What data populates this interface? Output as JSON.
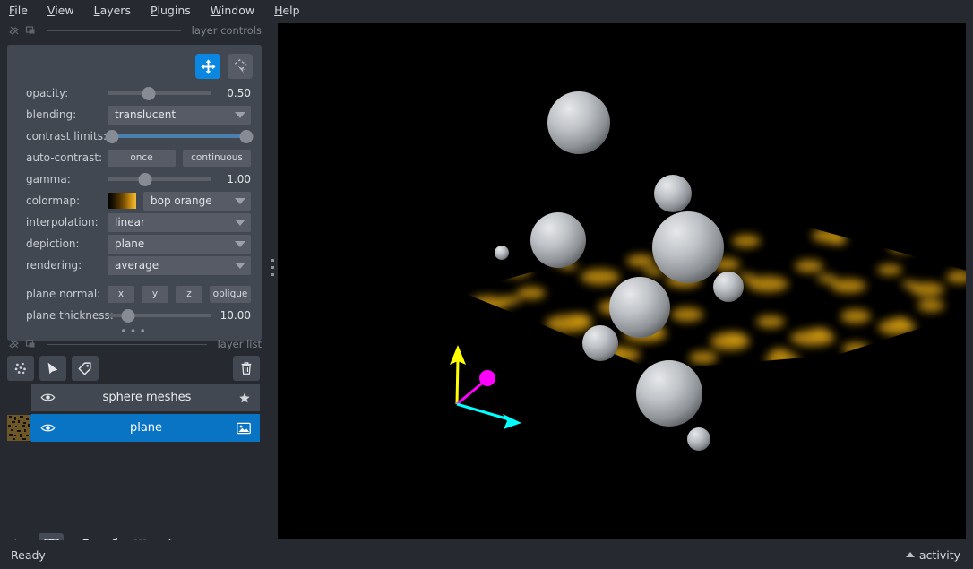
{
  "menubar": {
    "items": [
      {
        "label": "File",
        "mnemonic": "F"
      },
      {
        "label": "View",
        "mnemonic": "V"
      },
      {
        "label": "Layers",
        "mnemonic": "L"
      },
      {
        "label": "Plugins",
        "mnemonic": "P"
      },
      {
        "label": "Window",
        "mnemonic": "W"
      },
      {
        "label": "Help",
        "mnemonic": "H"
      }
    ]
  },
  "docks": {
    "layer_controls_title": "layer controls",
    "layer_list_title": "layer list",
    "overflow_dots": "•••"
  },
  "layer_controls": {
    "tools": [
      {
        "name": "pan-zoom-tool",
        "active": true
      },
      {
        "name": "transform-tool",
        "active": false
      }
    ],
    "opacity": {
      "label": "opacity:",
      "value": "0.50",
      "fraction": 0.4
    },
    "blending": {
      "label": "blending:",
      "value": "translucent"
    },
    "contrast_limits": {
      "label": "contrast limits:",
      "low": 0.0,
      "high": 1.0
    },
    "auto_contrast": {
      "label": "auto-contrast:",
      "once": "once",
      "continuous": "continuous"
    },
    "gamma": {
      "label": "gamma:",
      "value": "1.00",
      "fraction": 0.36
    },
    "colormap": {
      "label": "colormap:",
      "value": "bop orange"
    },
    "interpolation": {
      "label": "interpolation:",
      "value": "linear"
    },
    "depiction": {
      "label": "depiction:",
      "value": "plane"
    },
    "rendering": {
      "label": "rendering:",
      "value": "average"
    },
    "plane_normal": {
      "label": "plane normal:",
      "options": [
        "x",
        "y",
        "z",
        "oblique"
      ]
    },
    "plane_thickness": {
      "label": "plane thickness:",
      "value": "10.00",
      "fraction": 0.2
    }
  },
  "layer_buttons": [
    {
      "name": "new-points-layer-button",
      "icon": "points-icon"
    },
    {
      "name": "new-shapes-layer-button",
      "icon": "shapes-icon"
    },
    {
      "name": "new-labels-layer-button",
      "icon": "labels-icon"
    },
    {
      "name": "delete-layer-button",
      "icon": "trash-icon"
    }
  ],
  "layers": [
    {
      "name": "sphere meshes",
      "selected": false,
      "visible": true,
      "type_icon": "surface-icon",
      "has_thumbnail": false
    },
    {
      "name": "plane",
      "selected": true,
      "visible": true,
      "type_icon": "image-icon",
      "has_thumbnail": true
    }
  ],
  "viewer_buttons": [
    {
      "name": "console-button",
      "icon": "terminal-icon",
      "active": false
    },
    {
      "name": "ndisplay-button",
      "icon": "cube-3d-icon",
      "active": true
    },
    {
      "name": "roll-dims-button",
      "icon": "roll-cube-icon",
      "active": false
    },
    {
      "name": "transpose-dims-button",
      "icon": "transpose-icon",
      "active": false
    },
    {
      "name": "grid-view-button",
      "icon": "grid-icon",
      "active": false
    },
    {
      "name": "home-button",
      "icon": "home-icon",
      "active": false
    }
  ],
  "statusbar": {
    "status": "Ready",
    "activity_label": "activity"
  },
  "canvas": {
    "background": "#000000",
    "axes": [
      {
        "name": "axis-arrow-y",
        "color": "#ffff00"
      },
      {
        "name": "axis-arrow-z",
        "color": "#ff00ff"
      },
      {
        "name": "axis-arrow-x",
        "color": "#00ffff"
      }
    ],
    "plane_color": "#c8900f",
    "sphere_color": "#b4b7bb"
  },
  "colors": {
    "window_bg": "#262930",
    "panel_bg": "#414851",
    "control_bg": "#565b66",
    "accent": "#0a87e0",
    "selected_layer": "#0a74c4",
    "text": "#d8dade",
    "muted_text": "#7d828c"
  }
}
